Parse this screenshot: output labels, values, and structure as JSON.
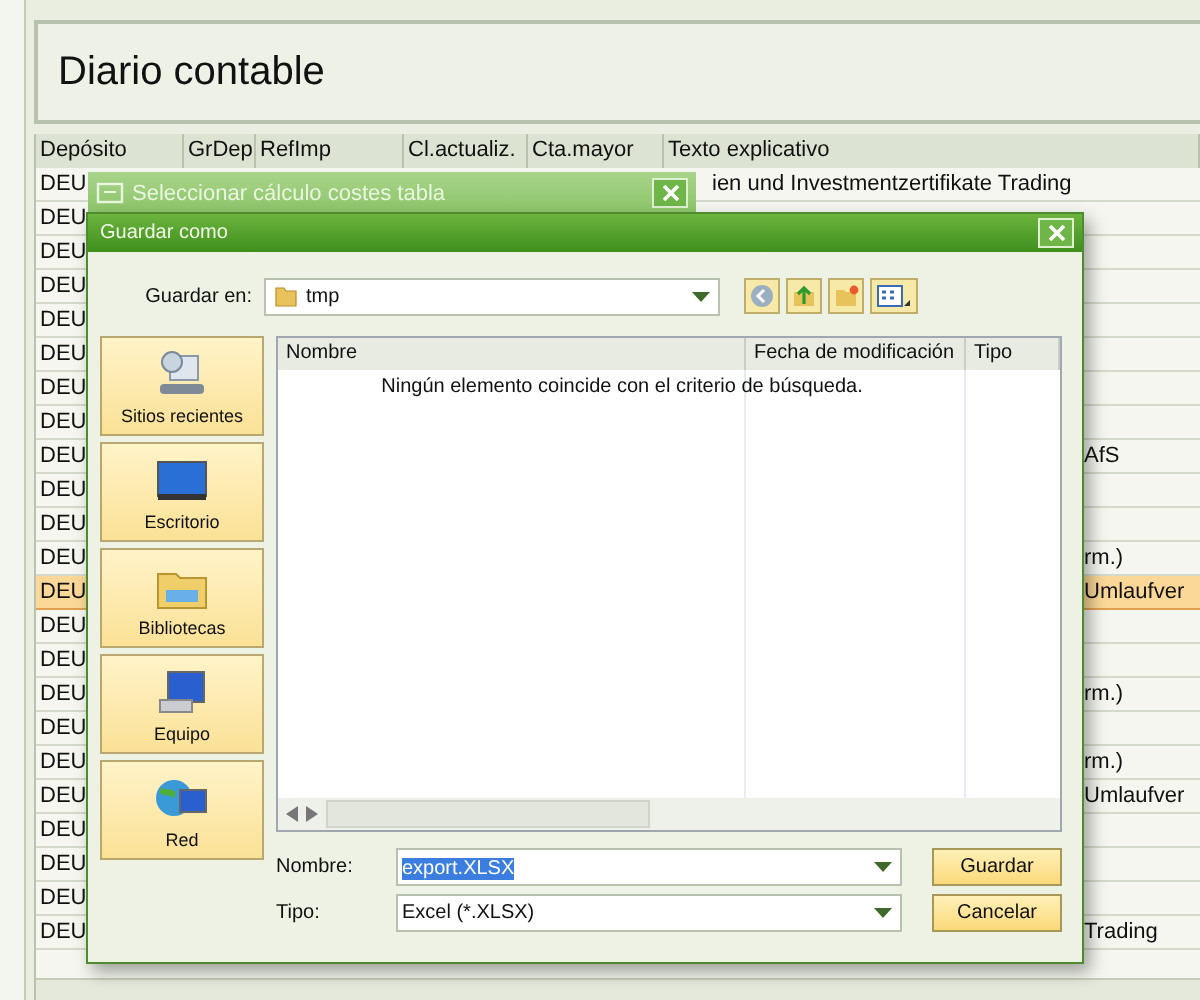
{
  "page": {
    "title": "Diario contable"
  },
  "table": {
    "columns": [
      "Depósito",
      "GrDep",
      "RefImp",
      "Cl.actualiz.",
      "Cta.mayor",
      "Texto explicativo"
    ],
    "rows": [
      {
        "deposito": "DEU",
        "texto": "ien und Investmentzertifikate Trading",
        "selected": false
      },
      {
        "deposito": "DEU",
        "selected": false
      },
      {
        "deposito": "DEU",
        "selected": false
      },
      {
        "deposito": "DEU",
        "selected": false
      },
      {
        "deposito": "DEU",
        "selected": false
      },
      {
        "deposito": "DEU",
        "selected": false
      },
      {
        "deposito": "DEU",
        "selected": false
      },
      {
        "deposito": "DEU",
        "selected": false
      },
      {
        "deposito": "DEU",
        "texto": "AfS",
        "selected": false
      },
      {
        "deposito": "DEU",
        "selected": false
      },
      {
        "deposito": "DEU",
        "selected": false
      },
      {
        "deposito": "DEU",
        "texto": "rm.)",
        "selected": false
      },
      {
        "deposito": "DEU",
        "texto": "Umlaufver",
        "selected": true
      },
      {
        "deposito": "DEU",
        "selected": false
      },
      {
        "deposito": "DEU",
        "selected": false
      },
      {
        "deposito": "DEU",
        "texto": "rm.)",
        "selected": false
      },
      {
        "deposito": "DEU",
        "selected": false
      },
      {
        "deposito": "DEU",
        "texto": "rm.)",
        "selected": false
      },
      {
        "deposito": "DEU",
        "texto": "Umlaufver",
        "selected": false
      },
      {
        "deposito": "DEU",
        "selected": false
      },
      {
        "deposito": "DEU",
        "selected": false
      },
      {
        "deposito": "DEU",
        "selected": false
      },
      {
        "deposito": "DEU",
        "texto": "Trading",
        "selected": false
      }
    ]
  },
  "background_dialog": {
    "title": "Seleccionar cálculo costes tabla"
  },
  "save_dialog": {
    "title": "Guardar como",
    "location_label": "Guardar en:",
    "location": "tmp",
    "places": [
      {
        "kind": "recent",
        "label": "Sitios recientes"
      },
      {
        "kind": "desktop",
        "label": "Escritorio"
      },
      {
        "kind": "libraries",
        "label": "Bibliotecas"
      },
      {
        "kind": "computer",
        "label": "Equipo"
      },
      {
        "kind": "network",
        "label": "Red"
      }
    ],
    "file_list": {
      "columns": [
        "Nombre",
        "Fecha de modificación",
        "Tipo"
      ],
      "empty_message": "Ningún elemento coincide con el criterio de búsqueda."
    },
    "filename_label": "Nombre:",
    "filename": "export.XLSX",
    "filetype_label": "Tipo:",
    "filetype": "Excel (*.XLSX)",
    "buttons": [
      "Guardar",
      "Cancelar"
    ]
  }
}
